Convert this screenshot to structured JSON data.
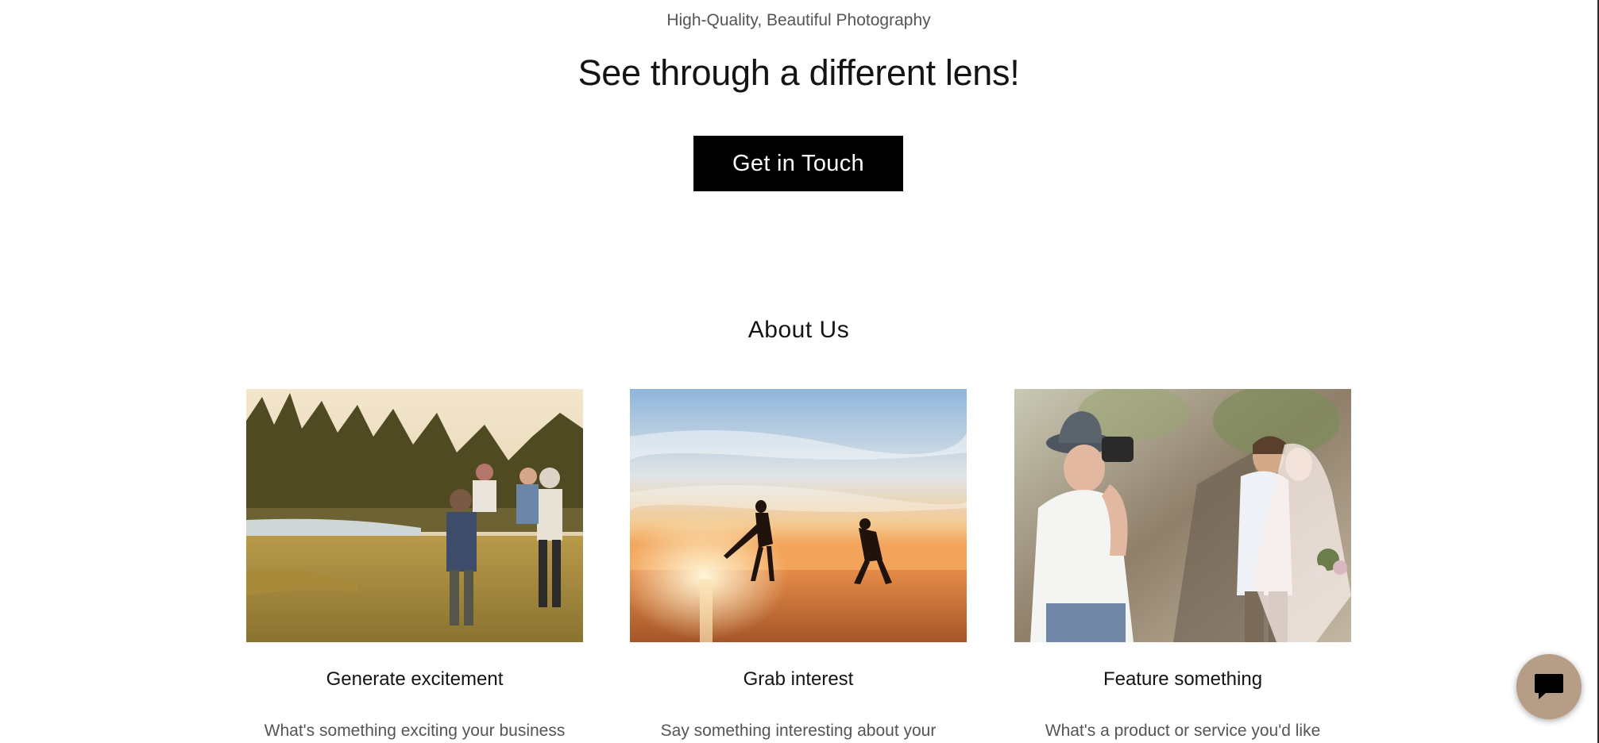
{
  "hero": {
    "eyebrow": "High-Quality, Beautiful Photography",
    "headline": "See through a different lens!",
    "cta_label": "Get in Touch"
  },
  "about": {
    "title": "About Us",
    "cards": [
      {
        "title": "Generate excitement",
        "text": "What's something exciting your business",
        "image_icon": "couples-walking-meadow-photo"
      },
      {
        "title": "Grab interest",
        "text": "Say something interesting about your",
        "image_icon": "beach-sunset-couple-photo"
      },
      {
        "title": "Feature something",
        "text": "What's a product or service you'd like",
        "image_icon": "wedding-photographer-photo"
      }
    ]
  },
  "chat": {
    "icon": "chat-bubble-icon"
  },
  "colors": {
    "accent": "#b59e85",
    "cta_bg": "#000000"
  }
}
